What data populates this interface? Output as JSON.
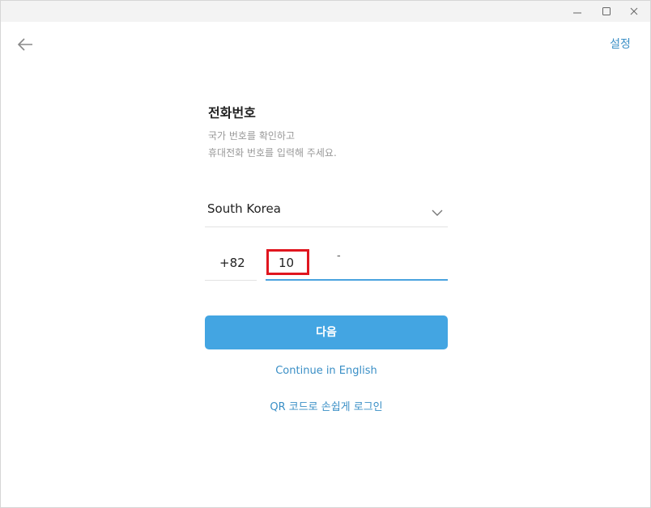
{
  "header": {
    "settings_label": "설정"
  },
  "window_controls": {
    "minimize_icon": "minimize-icon",
    "maximize_icon": "maximize-icon",
    "close_icon": "close-icon"
  },
  "login": {
    "title": "전화번호",
    "subtitle_line1": "국가 번호를 확인하고",
    "subtitle_line2": "휴대전화 번호를 입력해 주세요.",
    "country": "South Korea",
    "country_code": "+82",
    "phone_value": "10",
    "phone_separator": "-",
    "next_label": "다음",
    "english_link": "Continue in English",
    "qr_link": "QR 코드로 손쉽게 로그인"
  },
  "colors": {
    "accent": "#43a5e2",
    "link": "#3a8fc6",
    "highlight": "#e0161f"
  }
}
